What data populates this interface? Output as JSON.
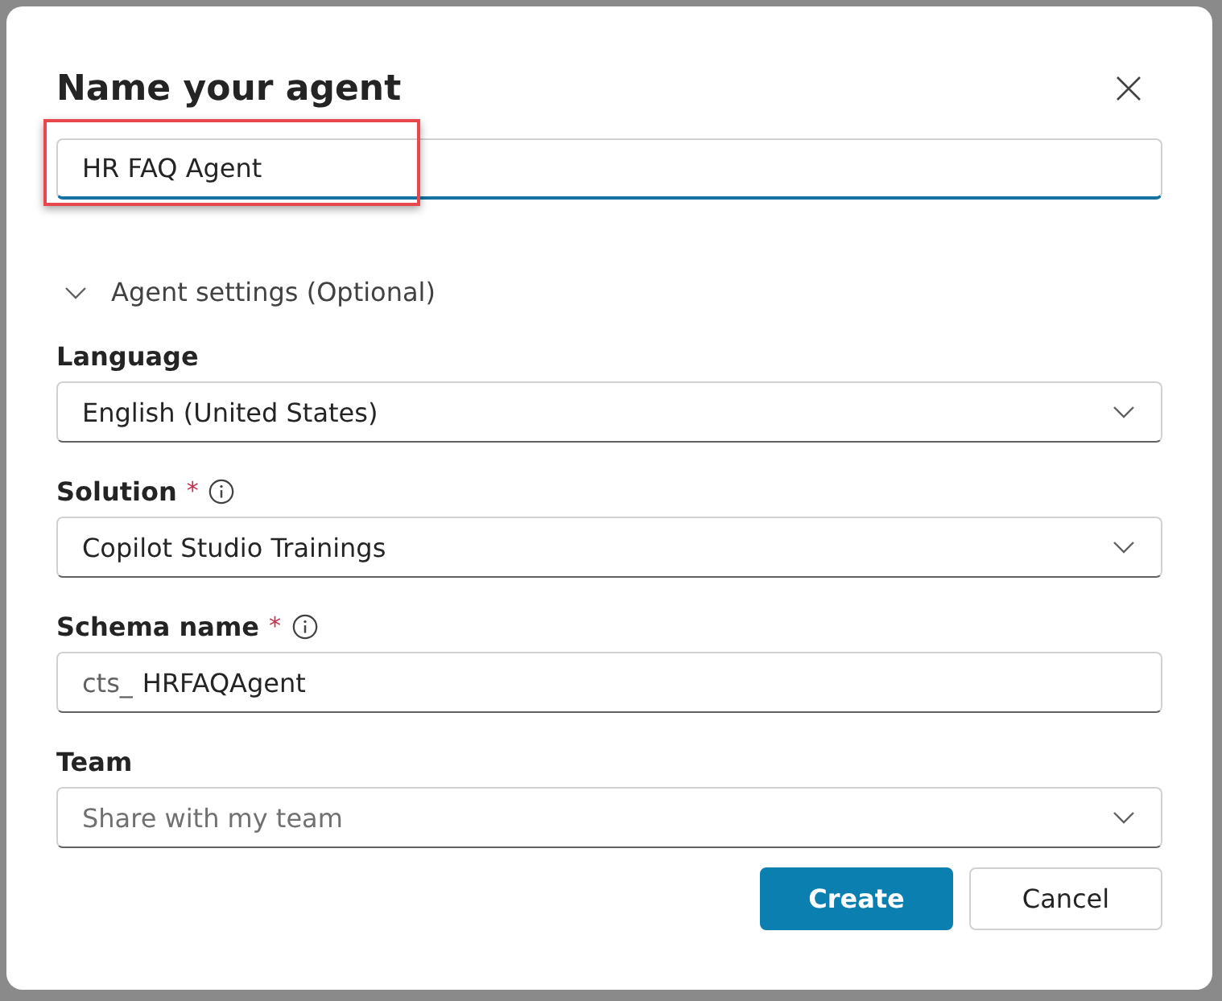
{
  "dialog": {
    "title": "Name your agent",
    "name_field": {
      "value": "HR FAQ Agent",
      "highlighted": true
    },
    "settings_toggle": {
      "label": "Agent settings (Optional)",
      "expanded": true
    },
    "fields": [
      {
        "kind": "select",
        "label": "Language",
        "info": false,
        "value": "English (United States)"
      },
      {
        "kind": "select",
        "label": "Solution",
        "required_mark": "*",
        "info": true,
        "value": "Copilot Studio Trainings"
      },
      {
        "kind": "text",
        "label": "Schema name",
        "required_mark": "*",
        "info": true,
        "prefix": "cts_",
        "value": "HRFAQAgent"
      },
      {
        "kind": "select",
        "label": "Team",
        "info": false,
        "placeholder": "Share with my team"
      }
    ],
    "buttons": [
      {
        "label": "Create",
        "primary": true
      },
      {
        "label": "Cancel",
        "primary": false
      }
    ]
  }
}
